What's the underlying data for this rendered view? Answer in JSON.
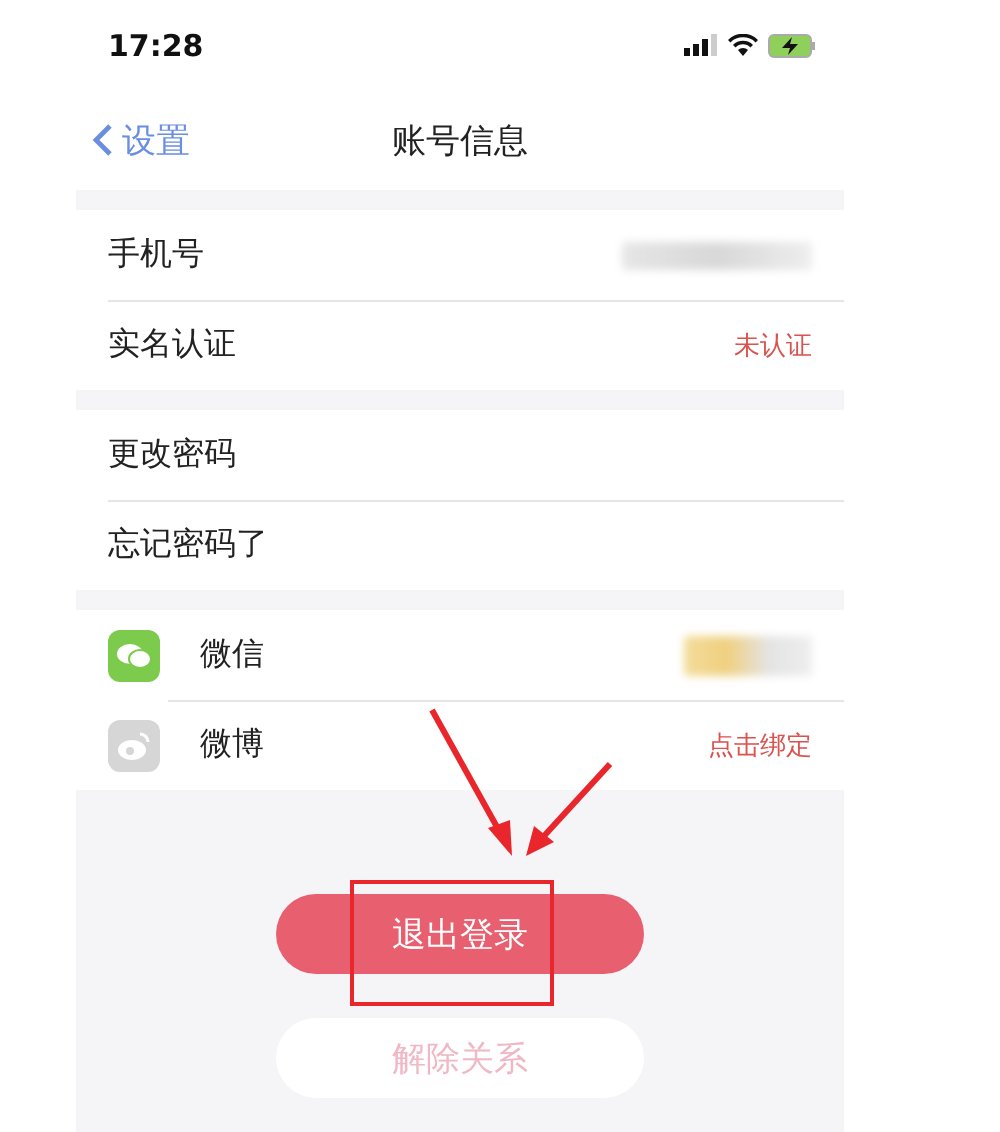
{
  "status_bar": {
    "time": "17:28"
  },
  "nav": {
    "back_label": "设置",
    "title": "账号信息"
  },
  "sections": [
    {
      "rows": [
        {
          "label": "手机号",
          "kind": "blurred"
        },
        {
          "label": "实名认证",
          "kind": "text",
          "value": "未认证"
        }
      ]
    },
    {
      "rows": [
        {
          "label": "更改密码",
          "kind": "plain"
        },
        {
          "label": "忘记密码了",
          "kind": "plain"
        }
      ]
    },
    {
      "rows": [
        {
          "label": "微信",
          "kind": "blurred"
        },
        {
          "label": "微博",
          "kind": "text",
          "value": "点击绑定"
        }
      ]
    }
  ],
  "buttons": [
    {
      "label": "退出登录",
      "kind": "primary"
    },
    {
      "label": "解除关系",
      "kind": "secondary"
    }
  ]
}
